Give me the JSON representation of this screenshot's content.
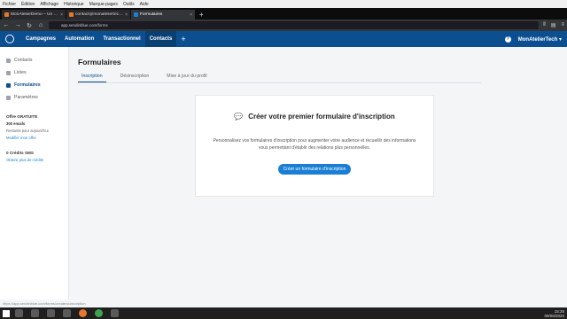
{
  "browser": {
    "menu": [
      "Fichier",
      "Édition",
      "Affichage",
      "Historique",
      "Marque-pages",
      "Outils",
      "Aide"
    ],
    "tabs": [
      {
        "label": "MonAtelierDemo – Un site ut..."
      },
      {
        "label": "contact@monateliertech.com"
      },
      {
        "label": "Formulaires"
      }
    ],
    "new_tab": "+",
    "url": "app.sendinblue.com/forms",
    "status_url": "https://app.sendinblue.com/forms/create/subscription"
  },
  "app": {
    "nav": [
      "Campagnes",
      "Automation",
      "Transactionnel",
      "Contacts"
    ],
    "add": "+",
    "help": "?",
    "account": "MonAtelierTech"
  },
  "sidebar": {
    "items": [
      {
        "label": "Contacts",
        "icon": "user-icon"
      },
      {
        "label": "Listes",
        "icon": "list-icon"
      },
      {
        "label": "Formulaires",
        "icon": "form-icon"
      },
      {
        "label": "Paramètres",
        "icon": "gear-icon"
      }
    ],
    "plan_title": "Offre GRATUITE",
    "emails": "300 emails",
    "remaining": "Restants pour aujourd'hui",
    "change_plan": "Modifier mon offre",
    "sms_title": "0 Crédits SMS",
    "sms_link": "Obtenir plus de crédits"
  },
  "page": {
    "title": "Formulaires",
    "tabs": [
      "Inscription",
      "Désinscription",
      "Mise à jour du profil"
    ],
    "card_title": "Créer votre premier formulaire d'inscription",
    "card_desc": "Personnalisez vos formulaires d'inscription pour augmenter votre audience et recueillir des informations vous permettant d'établir des relations plus personnelles.",
    "cta": "Créer un formulaire d'inscription"
  },
  "taskbar": {
    "time": "15:25",
    "date": "09/09/2020"
  },
  "colors": {
    "brand": "#0b4f91",
    "accent": "#1a7fd4"
  }
}
